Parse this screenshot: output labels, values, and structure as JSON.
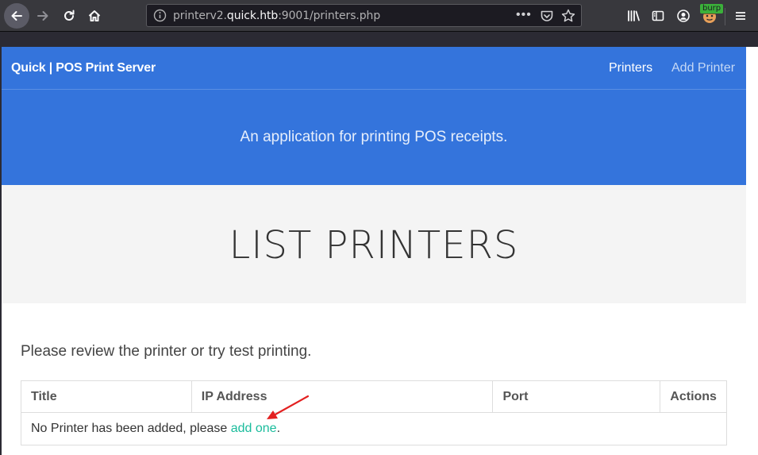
{
  "browser": {
    "url_prefix": "printerv2.",
    "url_host": "quick.htb",
    "url_suffix": ":9001/printers.php",
    "more_label": "•••",
    "extension_badge": "burp"
  },
  "navbar": {
    "brand": "Quick | POS Print Server",
    "links": [
      {
        "label": "Printers"
      },
      {
        "label": "Add Printer"
      }
    ]
  },
  "hero": {
    "tagline": "An application for printing POS receipts."
  },
  "banner": {
    "title": "LIST PRINTERS"
  },
  "main": {
    "intro": "Please review the printer or try test printing.",
    "table": {
      "headers": [
        "Title",
        "IP Address",
        "Port",
        "Actions"
      ],
      "empty_text": "No Printer has been added, please ",
      "empty_link": "add one",
      "empty_end": "."
    }
  },
  "colors": {
    "primary": "#3474dc",
    "link": "#1abc9c",
    "annotation": "#e32020"
  }
}
